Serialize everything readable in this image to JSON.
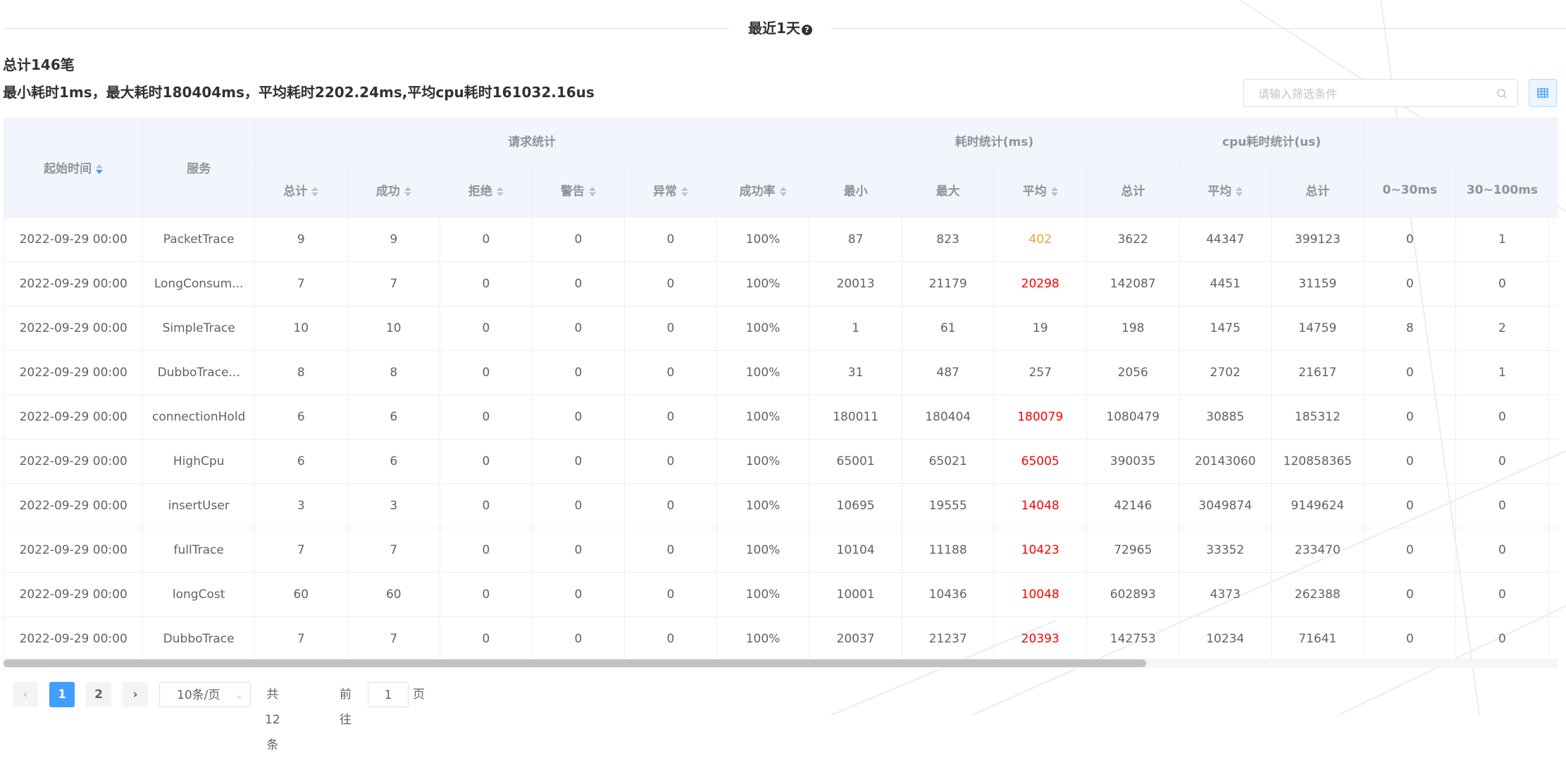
{
  "header": {
    "title": "最近1天",
    "help_icon": "question-circle-icon"
  },
  "summary": {
    "total_line": "总计146笔",
    "stats_line": "最小耗时1ms，最大耗时180404ms，平均耗时2202.24ms,平均cpu耗时161032.16us"
  },
  "search": {
    "placeholder": "请输入筛选条件",
    "value": ""
  },
  "colors": {
    "primary": "#409eff",
    "warn": "#e6a23c",
    "danger": "#f00"
  },
  "table": {
    "group_headers": {
      "start_time": "起始时间",
      "service": "服务",
      "requests": "请求统计",
      "latency": "耗时统计(ms)",
      "cpu": "cpu耗时统计(us)",
      "buckets": ""
    },
    "sub_headers": {
      "req_total": "总计",
      "req_success": "成功",
      "req_reject": "拒绝",
      "req_warn": "警告",
      "req_error": "异常",
      "req_rate": "成功率",
      "lat_min": "最小",
      "lat_max": "最大",
      "lat_avg": "平均",
      "lat_total": "总计",
      "cpu_avg": "平均",
      "cpu_total": "总计",
      "b1": "0~30ms",
      "b2": "30~100ms"
    },
    "rows": [
      {
        "time": "2022-09-29 00:00",
        "service": "PacketTrace",
        "total": "9",
        "success": "9",
        "reject": "0",
        "warn": "0",
        "error": "0",
        "rate": "100%",
        "min": "87",
        "max": "823",
        "avg": "402",
        "avg_level": "warn",
        "sum": "3622",
        "cpu_avg": "44347",
        "cpu_total": "399123",
        "b1": "0",
        "b2": "1"
      },
      {
        "time": "2022-09-29 00:00",
        "service": "LongConsum...",
        "total": "7",
        "success": "7",
        "reject": "0",
        "warn": "0",
        "error": "0",
        "rate": "100%",
        "min": "20013",
        "max": "21179",
        "avg": "20298",
        "avg_level": "danger",
        "sum": "142087",
        "cpu_avg": "4451",
        "cpu_total": "31159",
        "b1": "0",
        "b2": "0"
      },
      {
        "time": "2022-09-29 00:00",
        "service": "SimpleTrace",
        "total": "10",
        "success": "10",
        "reject": "0",
        "warn": "0",
        "error": "0",
        "rate": "100%",
        "min": "1",
        "max": "61",
        "avg": "19",
        "avg_level": "normal",
        "sum": "198",
        "cpu_avg": "1475",
        "cpu_total": "14759",
        "b1": "8",
        "b2": "2"
      },
      {
        "time": "2022-09-29 00:00",
        "service": "DubboTrace...",
        "total": "8",
        "success": "8",
        "reject": "0",
        "warn": "0",
        "error": "0",
        "rate": "100%",
        "min": "31",
        "max": "487",
        "avg": "257",
        "avg_level": "normal",
        "sum": "2056",
        "cpu_avg": "2702",
        "cpu_total": "21617",
        "b1": "0",
        "b2": "1"
      },
      {
        "time": "2022-09-29 00:00",
        "service": "connectionHold",
        "total": "6",
        "success": "6",
        "reject": "0",
        "warn": "0",
        "error": "0",
        "rate": "100%",
        "min": "180011",
        "max": "180404",
        "avg": "180079",
        "avg_level": "danger",
        "sum": "1080479",
        "cpu_avg": "30885",
        "cpu_total": "185312",
        "b1": "0",
        "b2": "0"
      },
      {
        "time": "2022-09-29 00:00",
        "service": "HighCpu",
        "total": "6",
        "success": "6",
        "reject": "0",
        "warn": "0",
        "error": "0",
        "rate": "100%",
        "min": "65001",
        "max": "65021",
        "avg": "65005",
        "avg_level": "danger",
        "sum": "390035",
        "cpu_avg": "20143060",
        "cpu_total": "120858365",
        "b1": "0",
        "b2": "0"
      },
      {
        "time": "2022-09-29 00:00",
        "service": "insertUser",
        "total": "3",
        "success": "3",
        "reject": "0",
        "warn": "0",
        "error": "0",
        "rate": "100%",
        "min": "10695",
        "max": "19555",
        "avg": "14048",
        "avg_level": "danger",
        "sum": "42146",
        "cpu_avg": "3049874",
        "cpu_total": "9149624",
        "b1": "0",
        "b2": "0"
      },
      {
        "time": "2022-09-29 00:00",
        "service": "fullTrace",
        "total": "7",
        "success": "7",
        "reject": "0",
        "warn": "0",
        "error": "0",
        "rate": "100%",
        "min": "10104",
        "max": "11188",
        "avg": "10423",
        "avg_level": "danger",
        "sum": "72965",
        "cpu_avg": "33352",
        "cpu_total": "233470",
        "b1": "0",
        "b2": "0"
      },
      {
        "time": "2022-09-29 00:00",
        "service": "longCost",
        "total": "60",
        "success": "60",
        "reject": "0",
        "warn": "0",
        "error": "0",
        "rate": "100%",
        "min": "10001",
        "max": "10436",
        "avg": "10048",
        "avg_level": "danger",
        "sum": "602893",
        "cpu_avg": "4373",
        "cpu_total": "262388",
        "b1": "0",
        "b2": "0"
      },
      {
        "time": "2022-09-29 00:00",
        "service": "DubboTrace",
        "total": "7",
        "success": "7",
        "reject": "0",
        "warn": "0",
        "error": "0",
        "rate": "100%",
        "min": "20037",
        "max": "21237",
        "avg": "20393",
        "avg_level": "danger",
        "sum": "142753",
        "cpu_avg": "10234",
        "cpu_total": "71641",
        "b1": "0",
        "b2": "0"
      }
    ]
  },
  "pagination": {
    "prev_icon": "chevron-left-icon",
    "next_icon": "chevron-right-icon",
    "pages": [
      "1",
      "2"
    ],
    "current_page": "1",
    "page_size": "10条/页",
    "total": "共 12 条",
    "goto_label": "前往",
    "goto_value": "1",
    "page_unit": "页"
  }
}
